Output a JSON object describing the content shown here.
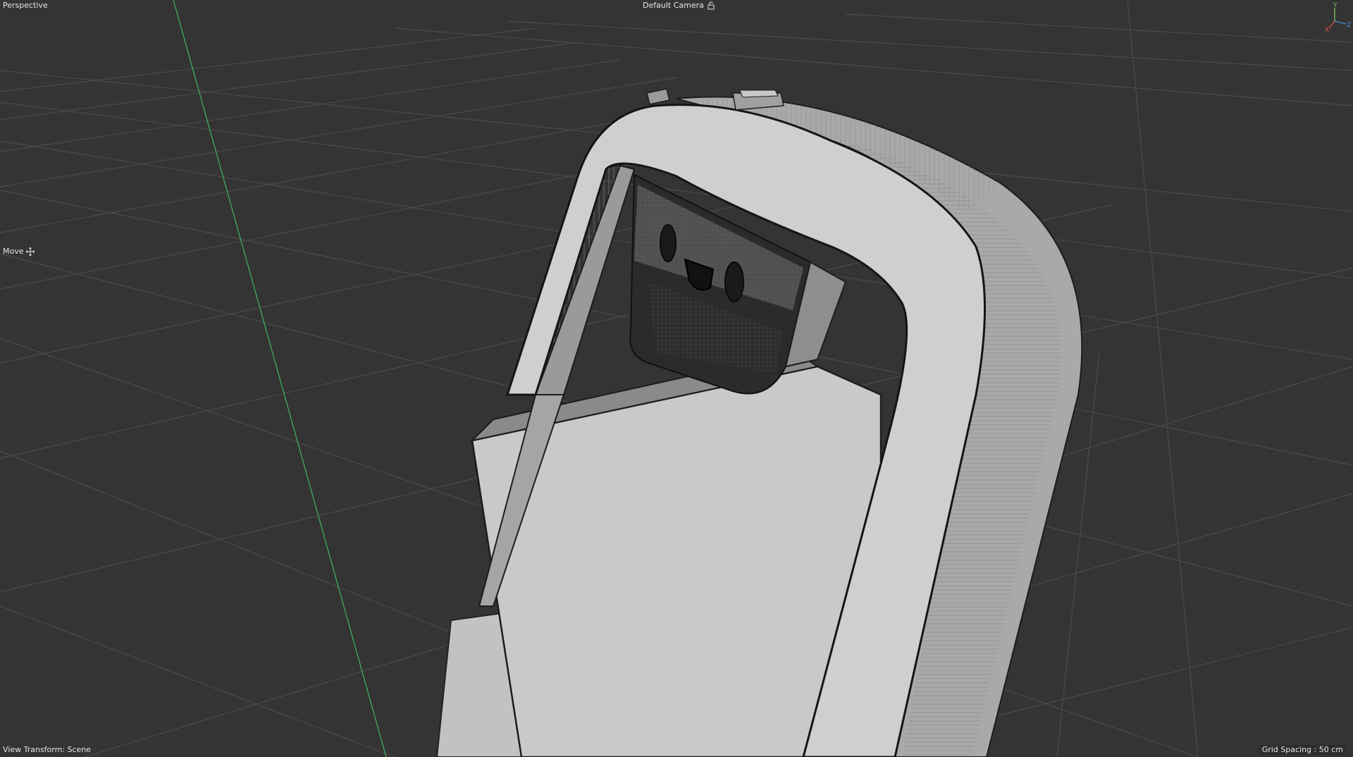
{
  "viewport": {
    "view_name": "Perspective",
    "camera_name": "Default Camera",
    "active_tool": "Move",
    "view_transform": "View Transform: Scene",
    "grid_spacing": "Grid Spacing : 50 cm"
  },
  "axis_gizmo": {
    "x_label": "X",
    "y_label": "Y",
    "z_label": "Z",
    "x_color": "#e0504a",
    "y_color": "#7cc45a",
    "z_color": "#4a8ee0"
  },
  "icons": {
    "camera_lock": "camera-lock-icon",
    "move_tool": "move-icon"
  },
  "colors": {
    "background": "#343434",
    "grid": "#4a4a4a",
    "y_axis_line": "#3fa55a",
    "model_light": "#cdcdcd",
    "model_mid": "#a8a8a8",
    "model_dark": "#2a2a2a"
  }
}
